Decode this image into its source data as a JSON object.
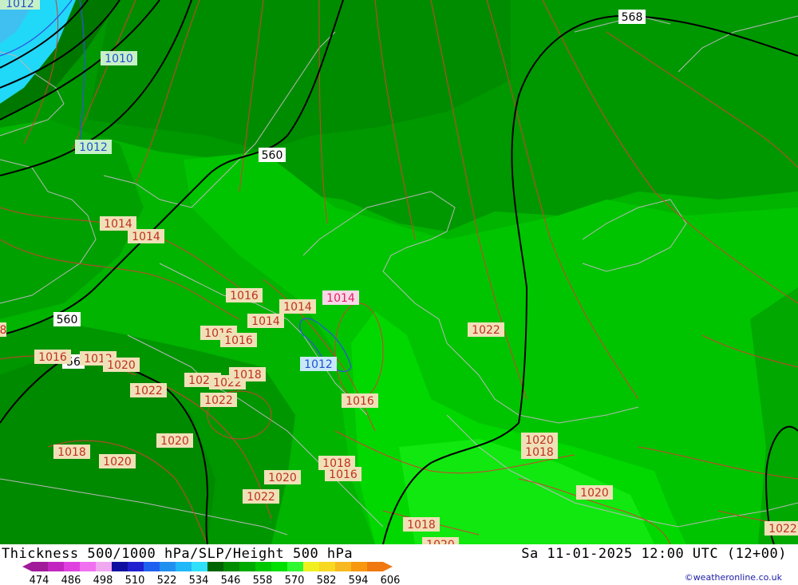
{
  "title": "Thickness 500/1000 hPa/SLP/Height 500 hPa",
  "datetime": "Sa 11-01-2025 12:00 UTC (12+00)",
  "credit": "©weatheronline.co.uk",
  "legend": {
    "ticks": [
      "474",
      "486",
      "498",
      "510",
      "522",
      "534",
      "546",
      "558",
      "570",
      "582",
      "594",
      "606"
    ],
    "colors": [
      "#a01a9a",
      "#c226c0",
      "#e040e0",
      "#f070f0",
      "#f0a8f0",
      "#1010a0",
      "#2020d0",
      "#2060f0",
      "#2090f0",
      "#20b8f8",
      "#30e0f8",
      "#006400",
      "#008c00",
      "#00aa00",
      "#00c800",
      "#00e000",
      "#30f830",
      "#f0f020",
      "#f8d820",
      "#f8b820",
      "#f89810",
      "#f07810"
    ]
  },
  "map": {
    "height_labels": [
      "568",
      "560",
      "560",
      "56"
    ],
    "slp_labels": [
      "1012",
      "1010",
      "1012",
      "1014",
      "1014",
      "1016",
      "1014",
      "1014",
      "1014",
      "1016",
      "1016",
      "1016",
      "1012",
      "1020",
      "1022",
      "1021",
      "1022",
      "1018",
      "1022",
      "1012",
      "1016",
      "1022",
      "1020",
      "1018",
      "1020",
      "1018",
      "1020",
      "1016",
      "1022",
      "1020",
      "1018",
      "1020",
      "1020",
      "1018",
      "1022",
      "1020",
      "8"
    ],
    "colors": {
      "slp_isobar": "#d04030",
      "low_isobar": "#3050e0",
      "height_contour": "#000000",
      "coastline": "#b8b8b8"
    }
  }
}
